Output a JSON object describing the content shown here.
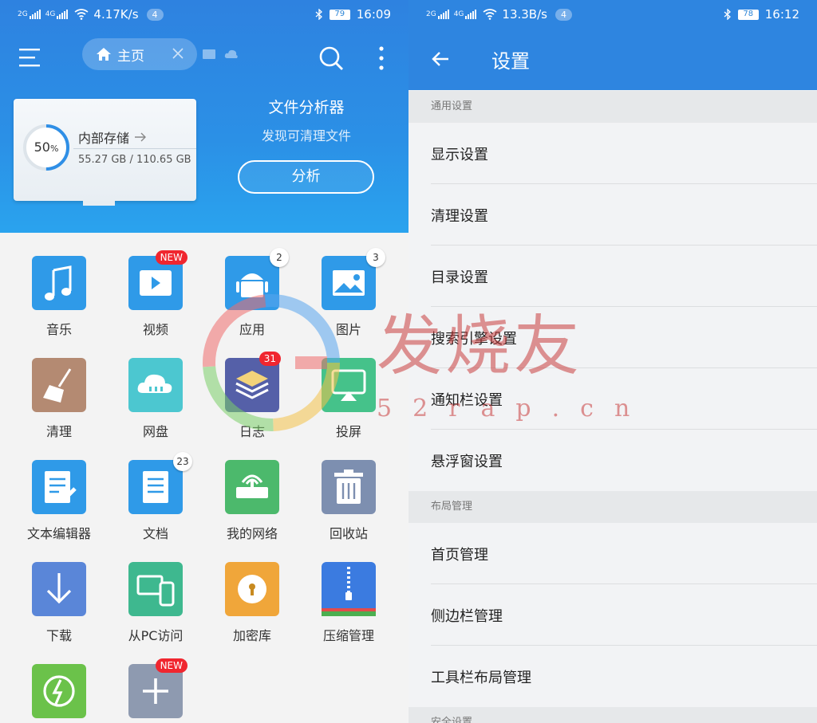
{
  "left": {
    "status": {
      "net1": "2G",
      "net2": "4G",
      "speed": "4.17K/s",
      "notif_count": "4",
      "battery": "79",
      "time": "16:09"
    },
    "header": {
      "tab_label": "主页",
      "menu_icon": "menu-icon",
      "search_icon": "search-icon",
      "more_icon": "more-vertical-icon"
    },
    "storage": {
      "percent": "50",
      "percent_sign": "%",
      "title": "内部存储",
      "size": "55.27 GB / 110.65 GB",
      "used_fraction": 0.5
    },
    "analyzer": {
      "title": "文件分析器",
      "subtitle": "发现可清理文件",
      "button": "分析"
    },
    "grid": [
      {
        "label": "音乐",
        "icon": "music-icon",
        "color": "#2f9ae8"
      },
      {
        "label": "视频",
        "icon": "video-icon",
        "color": "#2f9ae8",
        "badge": "NEW"
      },
      {
        "label": "应用",
        "icon": "android-icon",
        "color": "#2f9ae8",
        "badge": "2"
      },
      {
        "label": "图片",
        "icon": "image-icon",
        "color": "#2f9ae8",
        "badge": "3"
      },
      {
        "label": "清理",
        "icon": "broom-icon",
        "color": "#b48a72"
      },
      {
        "label": "网盘",
        "icon": "cloud-icon",
        "color": "#4cc7d0"
      },
      {
        "label": "日志",
        "icon": "log-icon",
        "color": "#5560a8",
        "badge": "31"
      },
      {
        "label": "投屏",
        "icon": "cast-icon",
        "color": "#45c28a"
      },
      {
        "label": "文本编辑器",
        "icon": "text-editor-icon",
        "color": "#2f9ae8"
      },
      {
        "label": "文档",
        "icon": "document-icon",
        "color": "#2f9ae8",
        "badge": "23"
      },
      {
        "label": "我的网络",
        "icon": "network-icon",
        "color": "#4cb96c"
      },
      {
        "label": "回收站",
        "icon": "trash-icon",
        "color": "#7d8fb0"
      },
      {
        "label": "下载",
        "icon": "download-icon",
        "color": "#5a86d8"
      },
      {
        "label": "从PC访问",
        "icon": "pc-access-icon",
        "color": "#3eb88f"
      },
      {
        "label": "加密库",
        "icon": "lock-icon",
        "color": "#f0a63a"
      },
      {
        "label": "压缩管理",
        "icon": "zip-icon",
        "color": "#3b7be0"
      },
      {
        "label": "",
        "icon": "sync-icon",
        "color": "#6bc24a"
      },
      {
        "label": "",
        "icon": "add-icon",
        "color": "#8e9ab0",
        "badge": "NEW"
      }
    ]
  },
  "right": {
    "status": {
      "net1": "2G",
      "net2": "4G",
      "speed": "13.3B/s",
      "notif_count": "4",
      "battery": "78",
      "time": "16:12"
    },
    "title": "设置",
    "sections": [
      {
        "header": "通用设置",
        "items": [
          "显示设置",
          "清理设置",
          "目录设置",
          "搜索引擎设置",
          "通知栏设置",
          "悬浮窗设置"
        ]
      },
      {
        "header": "布局管理",
        "items": [
          "首页管理",
          "侧边栏管理",
          "工具栏布局管理"
        ]
      },
      {
        "header": "安全设置",
        "items": []
      }
    ]
  },
  "watermark": {
    "text": "发烧友",
    "sub": "52rap.cn"
  }
}
